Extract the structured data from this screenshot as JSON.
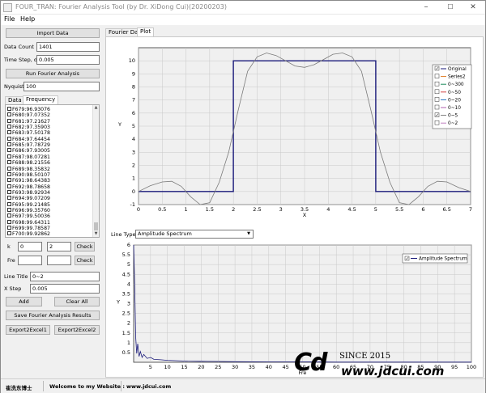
{
  "window": {
    "title": "FOUR_TRAN: Fourier Analysis Tool (by Dr. XiDong Cui)(20200203)",
    "minimize": "–",
    "maximize": "☐",
    "close": "✕"
  },
  "menu": {
    "file": "File",
    "help": "Help"
  },
  "left": {
    "import_button": "Import Data",
    "data_count_label": "Data Count",
    "data_count_value": "1401",
    "time_step_label": "Time Step, dx",
    "time_step_value": "0.005",
    "run_button": "Run Fourier Analysis",
    "nyquist_label": "Nyquist",
    "nyquist_value": "100",
    "tabs": [
      "Data",
      "Frequency"
    ],
    "list_items": [
      "F679:96.93076",
      "F680:97.07352",
      "F681:97.21627",
      "F682:97.35903",
      "F683:97.50178",
      "F684:97.64454",
      "F685:97.78729",
      "F686:97.93005",
      "F687:98.07281",
      "F688:98.21556",
      "F689:98.35832",
      "F690:98.50107",
      "F691:98.64383",
      "F692:98.78658",
      "F693:98.92934",
      "F694:99.07209",
      "F695:99.21485",
      "F696:99.35760",
      "F697:99.50036",
      "F698:99.64311",
      "F699:99.78587",
      "F700:99.92862"
    ],
    "k_label": "k",
    "k_from": "0",
    "k_to": "2",
    "check_label": "Check",
    "fre_label": "Fre",
    "fre_from": "",
    "fre_to": "",
    "line_title_label": "Line Title",
    "line_title_value": "0~2",
    "x_step_label": "X Step",
    "x_step_value": "0.005",
    "add_button": "Add",
    "clear_button": "Clear All",
    "save_button": "Save Fourier Analysis Results",
    "export1_button": "Export2Excel1",
    "export2_button": "Export2Excel2"
  },
  "right_tabs": [
    "Fourier Data",
    "Plot"
  ],
  "line_type_label": "Line Type",
  "line_type_value": "Amplitude Spectrum",
  "chart_data": [
    {
      "type": "line",
      "xlabel": "X",
      "ylabel": "Y",
      "xlim": [
        0,
        7
      ],
      "ylim": [
        -1,
        11
      ],
      "x_ticks": [
        "0",
        "0.5",
        "1",
        "1.5",
        "2",
        "2.5",
        "3",
        "3.5",
        "4",
        "4.5",
        "5",
        "5.5",
        "6",
        "6.5",
        "7"
      ],
      "y_ticks": [
        "-1",
        "0",
        "1",
        "2",
        "3",
        "4",
        "5",
        "6",
        "7",
        "8",
        "9",
        "10"
      ],
      "grid": true,
      "legend_position": "top-right",
      "series": [
        {
          "name": "Original",
          "checked": true,
          "color": "#1a1a7a",
          "x": [
            0,
            2,
            2,
            5,
            5,
            7
          ],
          "y": [
            0,
            0,
            10,
            10,
            0,
            0
          ]
        },
        {
          "name": "Series2",
          "checked": false,
          "color": "#e07a20"
        },
        {
          "name": "0~300",
          "checked": false,
          "color": "#1b8a5a"
        },
        {
          "name": "0~50",
          "checked": false,
          "color": "#d04040"
        },
        {
          "name": "0~20",
          "checked": false,
          "color": "#2070c0"
        },
        {
          "name": "0~10",
          "checked": false,
          "color": "#b060b0"
        },
        {
          "name": "0~5",
          "checked": true,
          "color": "#7a7a7a",
          "x": [
            0,
            0.25,
            0.5,
            0.7,
            0.9,
            1.1,
            1.3,
            1.5,
            1.7,
            1.9,
            2.1,
            2.3,
            2.5,
            2.7,
            2.9,
            3.1,
            3.3,
            3.5,
            3.7,
            3.9,
            4.1,
            4.3,
            4.5,
            4.7,
            4.9,
            5.1,
            5.3,
            5.5,
            5.7,
            5.9,
            6.1,
            6.3,
            6.5,
            6.75,
            7
          ],
          "y": [
            0.0,
            0.45,
            0.73,
            0.78,
            0.4,
            -0.4,
            -1.0,
            -0.86,
            0.7,
            3.0,
            6.2,
            9.2,
            10.3,
            10.6,
            10.4,
            10.0,
            9.6,
            9.5,
            9.7,
            10.1,
            10.5,
            10.6,
            10.3,
            9.2,
            6.2,
            3.0,
            0.7,
            -0.86,
            -1.0,
            -0.4,
            0.4,
            0.78,
            0.73,
            0.3,
            0.0
          ]
        },
        {
          "name": "0~2",
          "checked": false,
          "color": "#c080c0"
        }
      ]
    },
    {
      "type": "line",
      "xlabel": "Fre",
      "ylabel": "Y",
      "xlim": [
        0,
        100
      ],
      "ylim": [
        0,
        6
      ],
      "x_ticks": [
        "5",
        "10",
        "15",
        "20",
        "25",
        "30",
        "35",
        "40",
        "45",
        "50",
        "55",
        "60",
        "65",
        "70",
        "75",
        "80",
        "85",
        "90",
        "95",
        "100"
      ],
      "y_ticks": [
        "0.5",
        "1",
        "1.5",
        "2",
        "2.5",
        "3",
        "3.5",
        "4",
        "4.5",
        "5",
        "5.5",
        "6"
      ],
      "grid": true,
      "legend_position": "top-right",
      "series": [
        {
          "name": "Amplitude Spectrum",
          "checked": true,
          "color": "#1a1a7a",
          "x": [
            0,
            0.3,
            0.6,
            0.9,
            1.2,
            1.6,
            2,
            2.5,
            3,
            4,
            5,
            6,
            8,
            10,
            13,
            16,
            20,
            25,
            30,
            40,
            50,
            60,
            70,
            80,
            90,
            100
          ],
          "y": [
            6.0,
            3.9,
            1.3,
            0.45,
            0.95,
            0.3,
            0.55,
            0.25,
            0.4,
            0.2,
            0.25,
            0.15,
            0.13,
            0.1,
            0.08,
            0.06,
            0.05,
            0.04,
            0.03,
            0.02,
            0.02,
            0.01,
            0.01,
            0.01,
            0.01,
            0.01
          ]
        }
      ]
    }
  ],
  "status": {
    "author": "崔洗东博士",
    "welcome": "Welcome to my Website :",
    "website": "www.jdcui.com"
  },
  "watermark": {
    "logo": "Cd",
    "since": "SINCE 2015",
    "site": "www.jdcui.com"
  }
}
